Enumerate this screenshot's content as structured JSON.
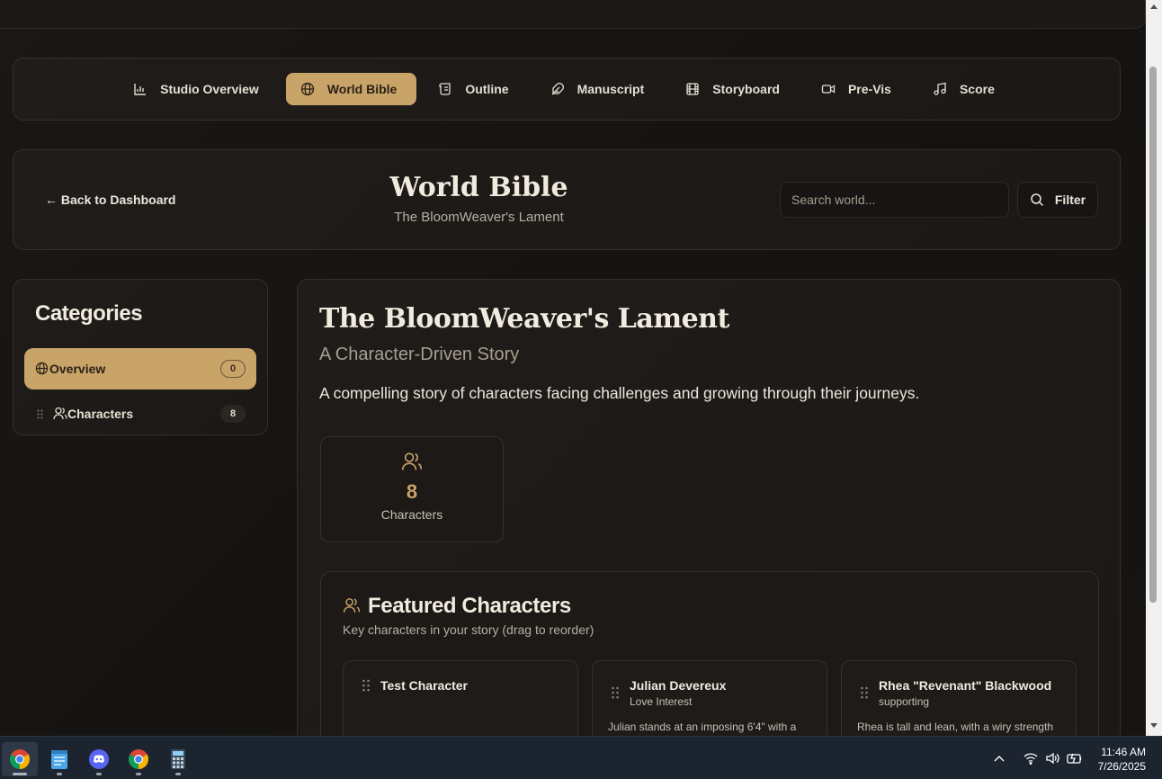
{
  "nav": {
    "items": [
      {
        "label": "Studio Overview",
        "icon": "bar-chart-icon"
      },
      {
        "label": "World Bible",
        "icon": "globe-icon",
        "active": true
      },
      {
        "label": "Outline",
        "icon": "scroll-icon"
      },
      {
        "label": "Manuscript",
        "icon": "feather-icon"
      },
      {
        "label": "Storyboard",
        "icon": "film-icon"
      },
      {
        "label": "Pre-Vis",
        "icon": "video-icon"
      },
      {
        "label": "Score",
        "icon": "music-icon"
      }
    ]
  },
  "header": {
    "back_label": "← Back to Dashboard",
    "title": "World Bible",
    "subtitle": "The BloomWeaver's Lament",
    "search_placeholder": "Search world...",
    "filter_label": "Filter"
  },
  "sidebar": {
    "title": "Categories",
    "items": [
      {
        "label": "Overview",
        "count": "0",
        "icon": "globe-icon",
        "active": true
      },
      {
        "label": "Characters",
        "count": "8",
        "icon": "users-icon"
      }
    ]
  },
  "main": {
    "title": "The BloomWeaver's Lament",
    "genre": "A Character-Driven Story",
    "description": "A compelling story of characters facing challenges and growing through their journeys.",
    "stat": {
      "value": "8",
      "label": "Characters"
    },
    "featured": {
      "title": "Featured Characters",
      "subtitle": "Key characters in your story (drag to reorder)",
      "characters": [
        {
          "name": "Test Character",
          "role": "",
          "desc": ""
        },
        {
          "name": "Julian Devereux",
          "role": "Love Interest",
          "desc": "Julian stands at an imposing 6'4\" with a"
        },
        {
          "name": "Rhea \"Revenant\" Blackwood",
          "role": "supporting",
          "desc": "Rhea is tall and lean, with a wiry strength"
        }
      ]
    }
  },
  "taskbar": {
    "apps": [
      "chrome-icon",
      "notepad-icon",
      "discord-icon",
      "chrome-icon",
      "calculator-icon"
    ],
    "time": "11:46 AM",
    "date": "7/26/2025"
  },
  "colors": {
    "accent": "#c9a469",
    "background": "#151311",
    "card": "#1f1c19"
  }
}
